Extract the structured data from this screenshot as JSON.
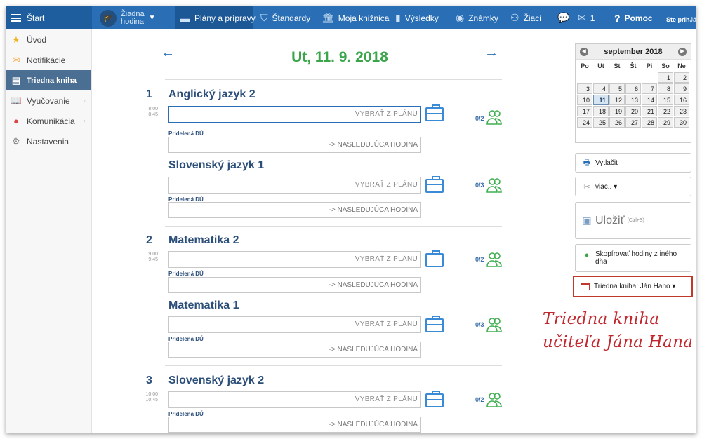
{
  "topbar": {
    "start": "Štart",
    "hour_line1": "Žiadna",
    "hour_line2": "hodina",
    "plans": "Plány a prípravy",
    "standards": "Štandardy",
    "library": "Moja knižnica",
    "results": "Výsledky",
    "grades": "Známky",
    "students": "Žiaci",
    "mail_count": "1",
    "help": "Pomoc",
    "user_line1": "Ste prih",
    "user_line2": "Ján Ha",
    "bar_color": "#2a6fb6"
  },
  "sidebar": {
    "items": [
      {
        "label": "Úvod",
        "icon": "star-icon"
      },
      {
        "label": "Notifikácie",
        "icon": "envelope-icon"
      },
      {
        "label": "Triedna kniha",
        "icon": "book-icon"
      },
      {
        "label": "Vyučovanie",
        "icon": "open-book-icon"
      },
      {
        "label": "Komunikácia",
        "icon": "chat-icon"
      },
      {
        "label": "Nastavenia",
        "icon": "gear-icon"
      }
    ]
  },
  "day": {
    "title": "Ut, 11. 9. 2018",
    "prev": "←",
    "next": "→"
  },
  "common": {
    "select_from_plan": "VYBRAŤ Z PLÁNU",
    "homework_label": "Pridelená DÚ",
    "next_lesson": "-> NASLEDUJÚCA HODINA"
  },
  "lessons": [
    {
      "number": "1",
      "time_from": "8:00",
      "time_to": "8:45",
      "subjects": [
        {
          "name": "Anglický jazyk  2",
          "ratio": "0/2"
        },
        {
          "name": "Slovenský jazyk  1",
          "ratio": "0/3"
        }
      ]
    },
    {
      "number": "2",
      "time_from": "9:00",
      "time_to": "9:45",
      "subjects": [
        {
          "name": "Matematika  2",
          "ratio": "0/2"
        },
        {
          "name": "Matematika  1",
          "ratio": "0/3"
        }
      ]
    },
    {
      "number": "3",
      "time_from": "10:00",
      "time_to": "10:45",
      "subjects": [
        {
          "name": "Slovenský jazyk  2",
          "ratio": "0/2"
        }
      ]
    }
  ],
  "calendar": {
    "month": "september 2018",
    "weekdays": [
      "Po",
      "Ut",
      "St",
      "Št",
      "Pi",
      "So",
      "Ne"
    ],
    "weeks": [
      [
        "",
        "",
        "",
        "",
        "",
        "1",
        "2"
      ],
      [
        "3",
        "4",
        "5",
        "6",
        "7",
        "8",
        "9"
      ],
      [
        "10",
        "11",
        "12",
        "13",
        "14",
        "15",
        "16"
      ],
      [
        "17",
        "18",
        "19",
        "20",
        "21",
        "22",
        "23"
      ],
      [
        "24",
        "25",
        "26",
        "27",
        "28",
        "29",
        "30"
      ]
    ],
    "selected": "11"
  },
  "actions": {
    "print": "Vytlačiť",
    "more": "viac.. ▾",
    "save": "Uložiť",
    "save_shortcut": "(Ctrl+S)",
    "copy_line1": "Skopírovať hodiny z iného",
    "copy_line2": "dňa",
    "class_book": "Triedna kniha: Ján Hano ▾"
  },
  "annotation": {
    "line1": "Triedna kniha",
    "line2": "učiteľa Jána Hana",
    "color": "#c0282e"
  }
}
